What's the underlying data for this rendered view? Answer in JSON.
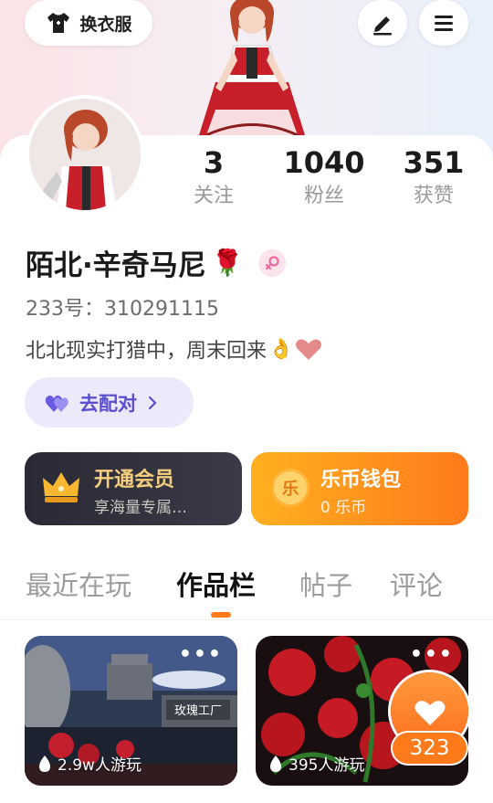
{
  "header": {
    "outfit_label": "换衣服"
  },
  "stats": [
    {
      "value": "3",
      "label": "关注"
    },
    {
      "value": "1040",
      "label": "粉丝"
    },
    {
      "value": "351",
      "label": "获赞"
    }
  ],
  "profile": {
    "name": "陌北·辛奇马尼",
    "name_emoji": "🌹",
    "id_label": "233号：",
    "id_value": "310291115",
    "bio": "北北现实打猎中，周末回来",
    "bio_emoji": "👌",
    "match_label": "去配对"
  },
  "vip": {
    "title": "开通会员",
    "subtitle": "享海量专属…"
  },
  "wallet": {
    "title": "乐币钱包",
    "subtitle": "0 乐币",
    "coin_glyph": "乐"
  },
  "tabs": [
    {
      "label": "最近在玩",
      "active": false
    },
    {
      "label": "作品栏",
      "active": true
    },
    {
      "label": "帖子",
      "active": false
    },
    {
      "label": "评论",
      "active": false
    }
  ],
  "works": [
    {
      "plays": "2.9w人游玩",
      "sign_text": "玫瑰工厂"
    },
    {
      "plays": "395人游玩"
    }
  ],
  "likes": {
    "count": "323"
  },
  "colors": {
    "accent_orange": "#ff7a1a",
    "match_purple": "#5b4fcf",
    "vip_gold": "#f5cf7e"
  }
}
